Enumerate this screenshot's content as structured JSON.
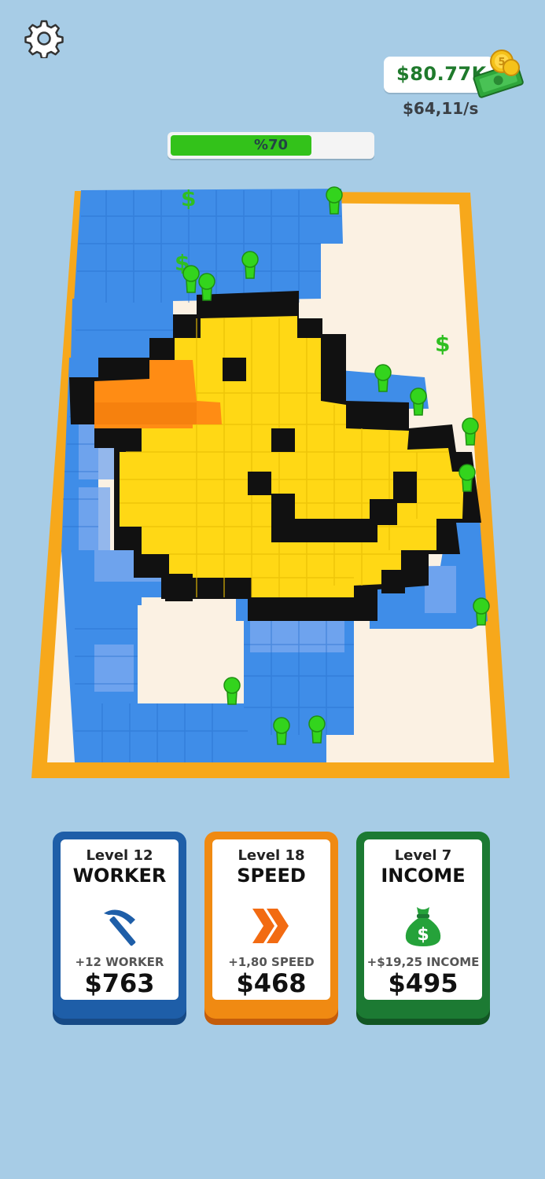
{
  "hud": {
    "money": "$80.77K",
    "rate": "$64,11/s",
    "progress_label": "%70",
    "progress_fraction": 0.7
  },
  "colors": {
    "background": "#a7cce6",
    "progress_green": "#33c21a",
    "worker_card": "#1e5ea8",
    "speed_card": "#f08a12",
    "income_card": "#1c7a33",
    "board_frame": "#f7a81b",
    "duck_yellow": "#ffd815",
    "duck_beak": "#ff8c14",
    "tile_blue": "#3f8de8",
    "worker_green": "#33d41d"
  },
  "icons": {
    "settings": "gear-icon",
    "money": "cash-coins-icon",
    "worker": "pickaxe-icon",
    "speed": "double-chevron-icon",
    "income": "money-bag-icon",
    "floating": "dollar-sign-icon"
  },
  "board": {
    "floating_dollars": [
      "$",
      "$",
      "$"
    ]
  },
  "cards": [
    {
      "level": "Level 12",
      "title": "WORKER",
      "bonus": "+12 WORKER",
      "price": "$763"
    },
    {
      "level": "Level 18",
      "title": "SPEED",
      "bonus": "+1,80 SPEED",
      "price": "$468"
    },
    {
      "level": "Level 7",
      "title": "INCOME",
      "bonus": "+$19,25 INCOME",
      "price": "$495"
    }
  ]
}
